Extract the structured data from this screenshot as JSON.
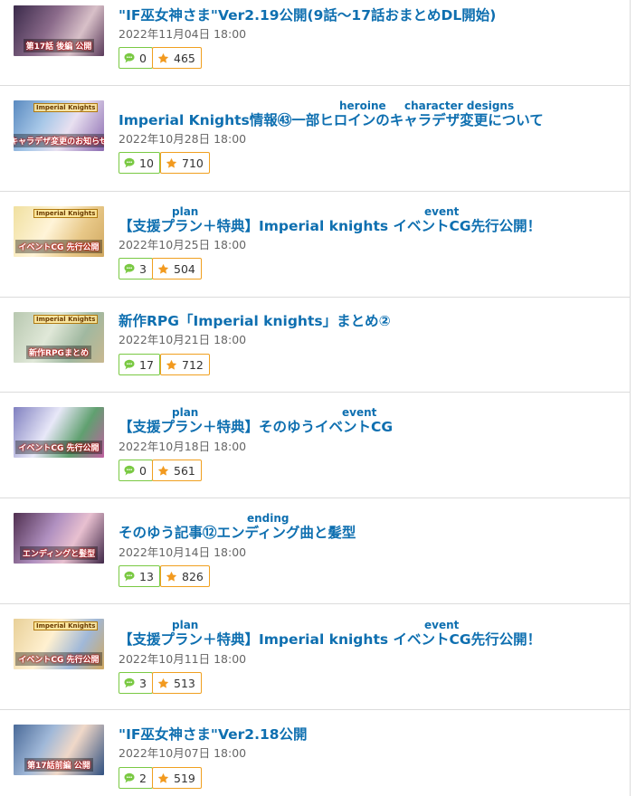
{
  "colors": {
    "title": "#0e6fb0",
    "comment": "#7ac943",
    "star": "#f29a1f"
  },
  "icons": {
    "comment": "speech-bubble-icon",
    "favorite": "star-icon"
  },
  "posts": [
    {
      "title": "\"IF巫女神さま\"Ver2.19公開(9話～17話おまとめDL開始)",
      "date": "2022年11月04日 18:00",
      "comments": "0",
      "likes": "465",
      "ruby": [],
      "thumb_caption": "第17話 後編 公開"
    },
    {
      "title": "Imperial Knights情報㊸一部ヒロインのキャラデザ変更について",
      "date": "2022年10月28日 18:00",
      "comments": "10",
      "likes": "710",
      "ruby": [
        "heroine",
        "character designs"
      ],
      "thumb_caption": "キャラデザ変更のお知らせ"
    },
    {
      "title": "【支援プラン＋特典】Imperial knights イベントCG先行公開！",
      "date": "2022年10月25日 18:00",
      "comments": "3",
      "likes": "504",
      "ruby": [
        "plan",
        "event"
      ],
      "thumb_caption": "イベントCG 先行公開"
    },
    {
      "title": "新作RPG「Imperial knights」まとめ②",
      "date": "2022年10月21日 18:00",
      "comments": "17",
      "likes": "712",
      "ruby": [],
      "thumb_caption": "新作RPGまとめ"
    },
    {
      "title": "【支援プラン＋特典】そのゆうイベントCG",
      "date": "2022年10月18日 18:00",
      "comments": "0",
      "likes": "561",
      "ruby": [
        "plan",
        "event"
      ],
      "thumb_caption": "イベントCG 先行公開"
    },
    {
      "title": "そのゆう記事⑫エンディング曲と髪型",
      "date": "2022年10月14日 18:00",
      "comments": "13",
      "likes": "826",
      "ruby": [
        "ending"
      ],
      "thumb_caption": "エンディングと髪型"
    },
    {
      "title": "【支援プラン＋特典】Imperial knights イベントCG先行公開！",
      "date": "2022年10月11日 18:00",
      "comments": "3",
      "likes": "513",
      "ruby": [
        "plan",
        "event"
      ],
      "thumb_caption": "イベントCG 先行公開"
    },
    {
      "title": "\"IF巫女神さま\"Ver2.18公開",
      "date": "2022年10月07日 18:00",
      "comments": "2",
      "likes": "519",
      "ruby": [],
      "thumb_caption": "第17話前編 公開"
    }
  ]
}
